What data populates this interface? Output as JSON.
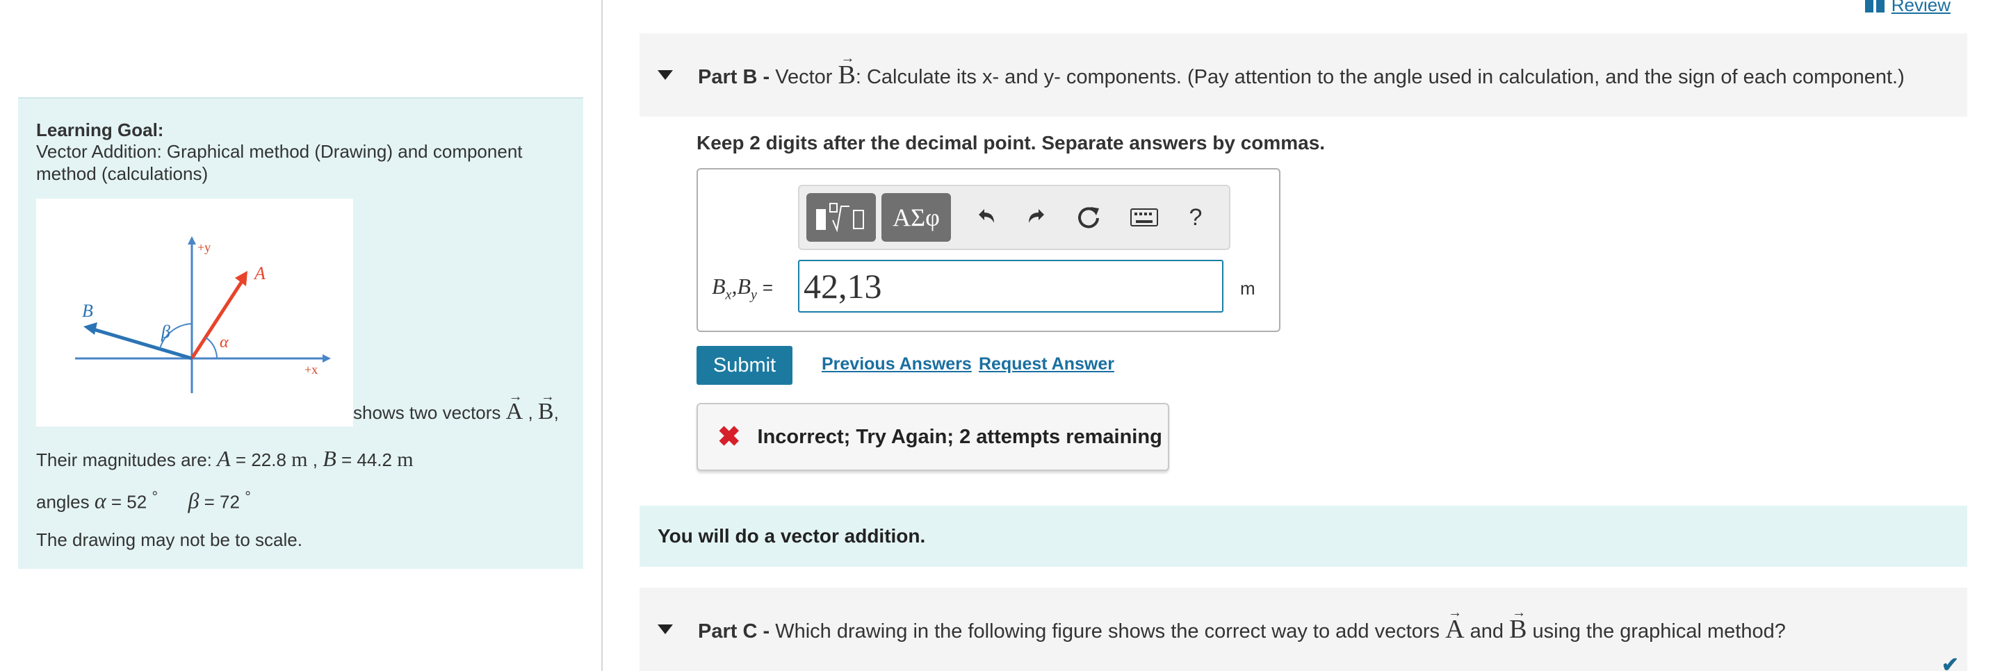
{
  "header": {
    "review_label": "Review"
  },
  "learning_goal": {
    "title": "Learning Goal:",
    "text": "Vector Addition: Graphical method (Drawing)  and component method (calculations)",
    "figure": {
      "plus_y": "+y",
      "plus_x": "+x",
      "vec_a": "A",
      "vec_b": "B",
      "alpha": "α",
      "beta": "β"
    },
    "caption_prefix": "shows two vectors",
    "caption_vec_a": "A",
    "caption_vec_b": "B",
    "caption_sep1": ",",
    "caption_sep2": ",",
    "magnitudes_prefix": "Their magnitudes are:",
    "mag_a_symbol": "A",
    "mag_a_eq": " = 22.8",
    "mag_a_unit": "m",
    "mag_sep": ",",
    "mag_b_symbol": "B",
    "mag_b_eq": " = 44.2",
    "mag_b_unit": "m",
    "angles_prefix": "angles",
    "alpha_symbol": "α",
    "alpha_eq": " = 52",
    "degree": "°",
    "beta_symbol": "β",
    "beta_eq": " = 72",
    "scale_note": "The drawing may not be to scale."
  },
  "part_b": {
    "label": "Part B -",
    "text_before": "Vector",
    "vector": "B",
    "text_after": ": Calculate its x- and y- components. (Pay attention to the angle used in calculation, and the sign of each component.)",
    "instruction": "Keep 2 digits after the decimal point. Separate answers by commas.",
    "toolbar": {
      "greek_label": "ΑΣφ",
      "help_label": "?"
    },
    "equation_label": "Bx,By",
    "equals": "=",
    "answer_value": "42,13",
    "unit": "m",
    "submit_label": "Submit",
    "previous_answers_label": "Previous Answers",
    "request_answer_label": "Request Answer",
    "feedback": "Incorrect; Try Again; 2 attempts remaining"
  },
  "info_banner": {
    "text": "You will do a vector addition."
  },
  "part_c": {
    "label": "Part C -",
    "text_before": "Which drawing in the following figure shows the correct way to add vectors",
    "vec_a": "A",
    "and": "and",
    "vec_b": "B",
    "text_after": "using the graphical method?"
  },
  "colors": {
    "accent": "#1c7aa1",
    "vector_a": "#e8442a",
    "vector_b": "#2a74b5",
    "error": "#d6202a",
    "panel_bg": "#e4f4f5"
  }
}
